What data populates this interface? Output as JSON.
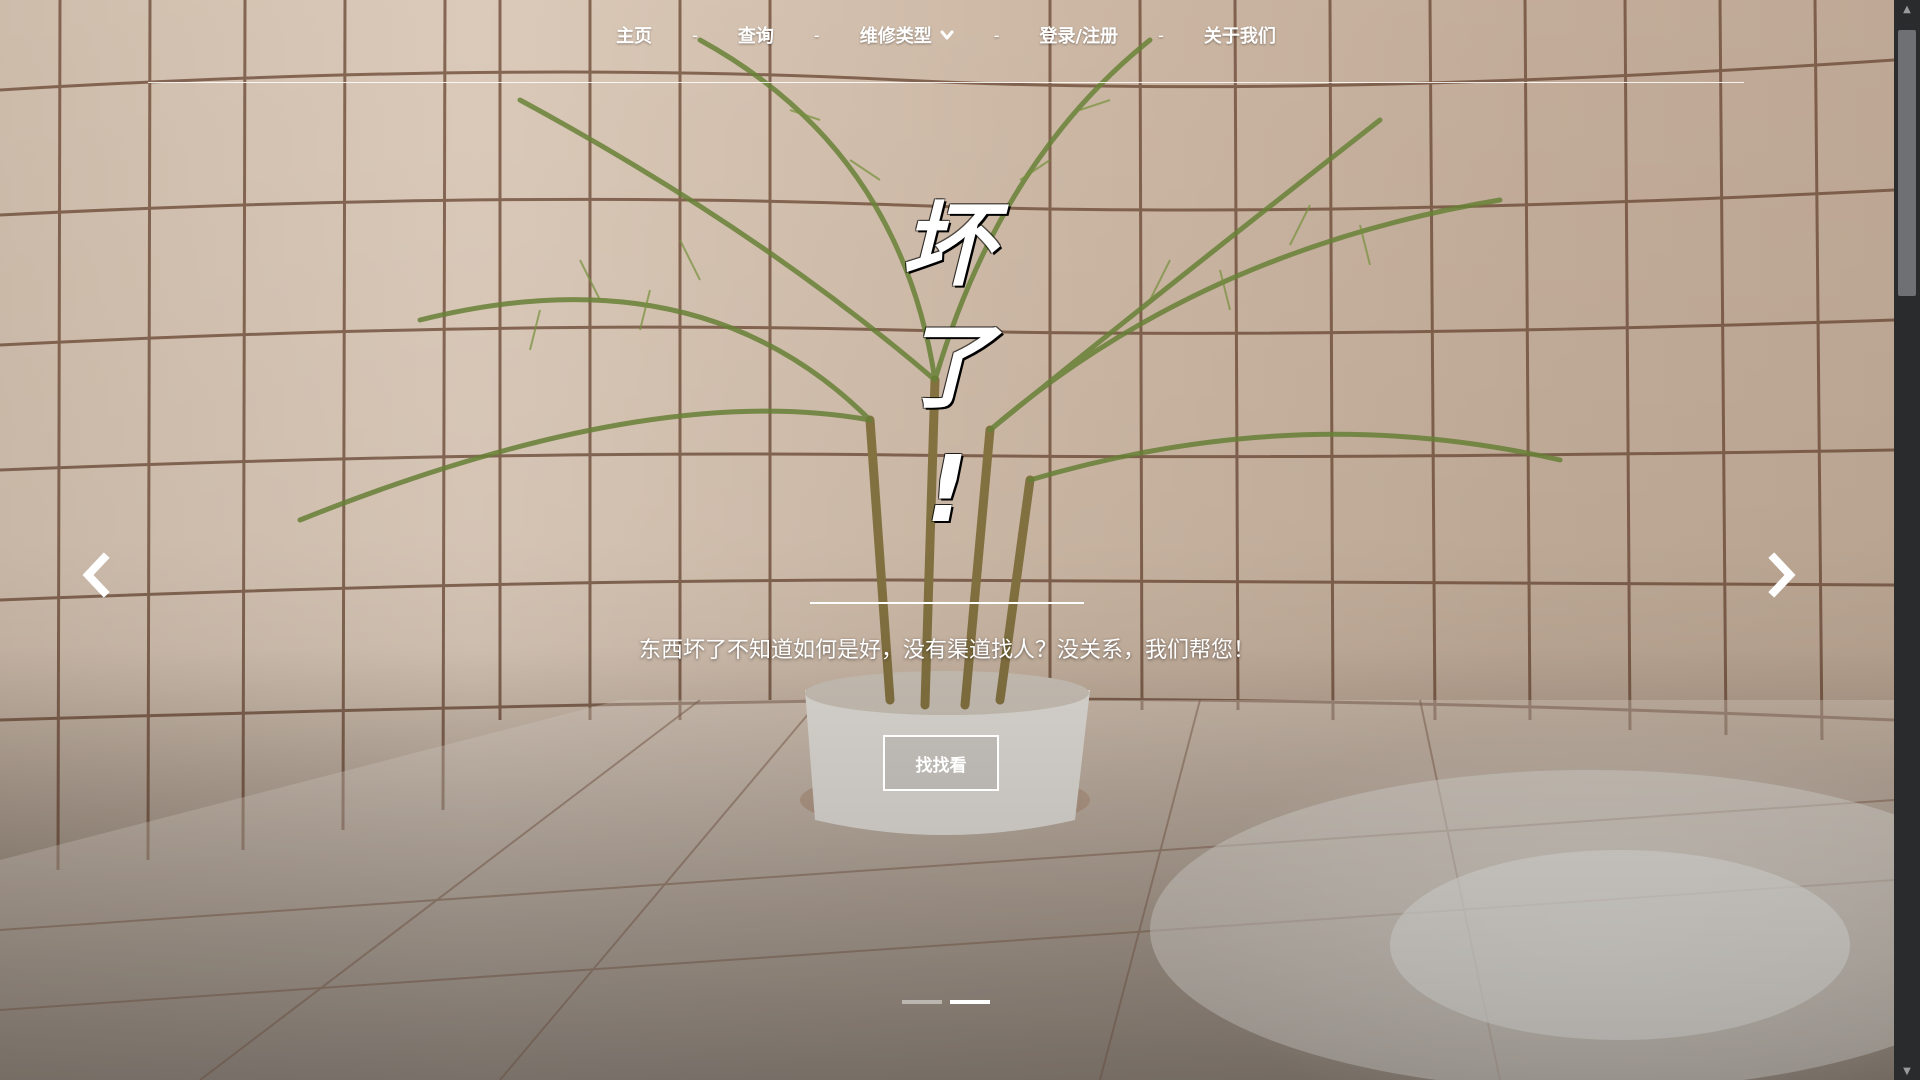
{
  "nav": {
    "items": [
      {
        "label": "主页"
      },
      {
        "label": "查询"
      },
      {
        "label": "维修类型",
        "has_dropdown": true
      },
      {
        "label": "登录/注册"
      },
      {
        "label": "关于我们"
      }
    ],
    "separator": "-"
  },
  "hero": {
    "title_chars": [
      "坏",
      "了",
      "!"
    ],
    "subtitle": "东西坏了不知道如何是好，没有渠道找人？没关系，我们帮您！",
    "cta_label": "找找看"
  },
  "carousel": {
    "slide_count": 2,
    "active_index": 1
  },
  "icons": {
    "prev": "chevron-left-icon",
    "next": "chevron-right-icon",
    "dropdown": "chevron-down-icon"
  },
  "colors": {
    "text": "#ffffff",
    "scrollbar_track": "#2a2b2d",
    "scrollbar_thumb": "#6f7074"
  }
}
